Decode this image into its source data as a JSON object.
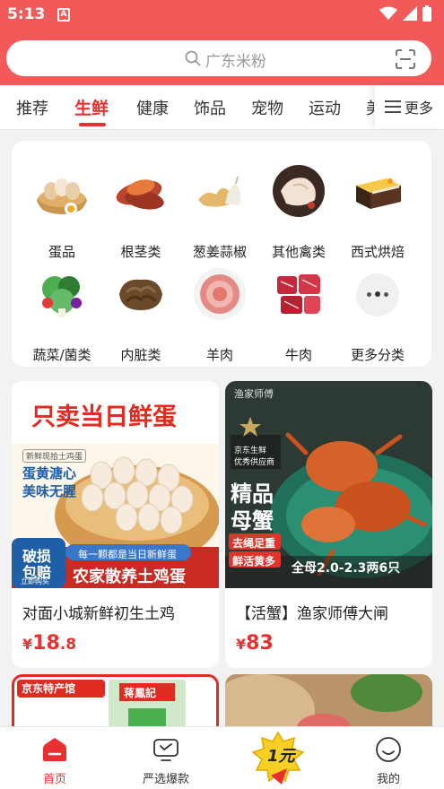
{
  "status_bar": {
    "time": "5:13",
    "app_badge": "A"
  },
  "search": {
    "placeholder": "广东米粉"
  },
  "tabs": [
    {
      "label": "推荐"
    },
    {
      "label": "生鲜"
    },
    {
      "label": "健康"
    },
    {
      "label": "饰品"
    },
    {
      "label": "宠物"
    },
    {
      "label": "运动"
    },
    {
      "label": "美"
    }
  ],
  "active_tab": "生鲜",
  "more": {
    "label": "更多"
  },
  "categories": [
    {
      "label": "蛋品",
      "icon": "eggs-icon"
    },
    {
      "label": "根茎类",
      "icon": "sweet-potato-icon"
    },
    {
      "label": "葱姜蒜椒",
      "icon": "ginger-garlic-icon"
    },
    {
      "label": "其他禽类",
      "icon": "poultry-icon"
    },
    {
      "label": "西式烘焙",
      "icon": "cake-icon"
    },
    {
      "label": "蔬菜/菌类",
      "icon": "vegetables-icon"
    },
    {
      "label": "内脏类",
      "icon": "offal-icon"
    },
    {
      "label": "羊肉",
      "icon": "lamb-icon"
    },
    {
      "label": "牛肉",
      "icon": "beef-icon"
    },
    {
      "label": "更多分类",
      "icon": "more-dots-icon"
    }
  ],
  "products": [
    {
      "title": "对面小城新鲜初生土鸡",
      "price_currency": "¥",
      "price_int": "18",
      "price_dec": ".8",
      "banner": {
        "headline": "只卖当日鲜蛋",
        "tag": "新鲜现拾土鸡蛋",
        "line1": "蛋黄溏心",
        "line2": "美味无腥",
        "badge1": "破损",
        "badge2": "包赔",
        "badge3": "立即购买",
        "ribbon": "每一颗都是当日新鲜蛋",
        "footer": "农家散养土鸡蛋"
      }
    },
    {
      "title": "【活蟹】渔家师傅大闸",
      "price_currency": "¥",
      "price_int": "83",
      "price_dec": "",
      "banner": {
        "brand": "渔家师傅",
        "supplier1": "京东生鲜",
        "supplier2": "优秀供应商",
        "headline1": "精品",
        "headline2": "母蟹",
        "tag1": "去绳足重",
        "tag2": "鲜活黄多",
        "spec": "全母2.0-2.3两6只"
      }
    }
  ],
  "peek_items": [
    {
      "badge": "京东特产馆",
      "brand": "蒋鳳記"
    }
  ],
  "bottom_nav": [
    {
      "label": "首页",
      "icon": "home-icon"
    },
    {
      "label": "严选爆款",
      "icon": "tv-icon"
    },
    {
      "label": "1元",
      "icon": "one-yuan-icon"
    },
    {
      "label": "我的",
      "icon": "profile-icon"
    }
  ],
  "colors": {
    "header_bg": "#f25a5a",
    "accent": "#e83030",
    "page_bg": "#f2f2f2"
  }
}
